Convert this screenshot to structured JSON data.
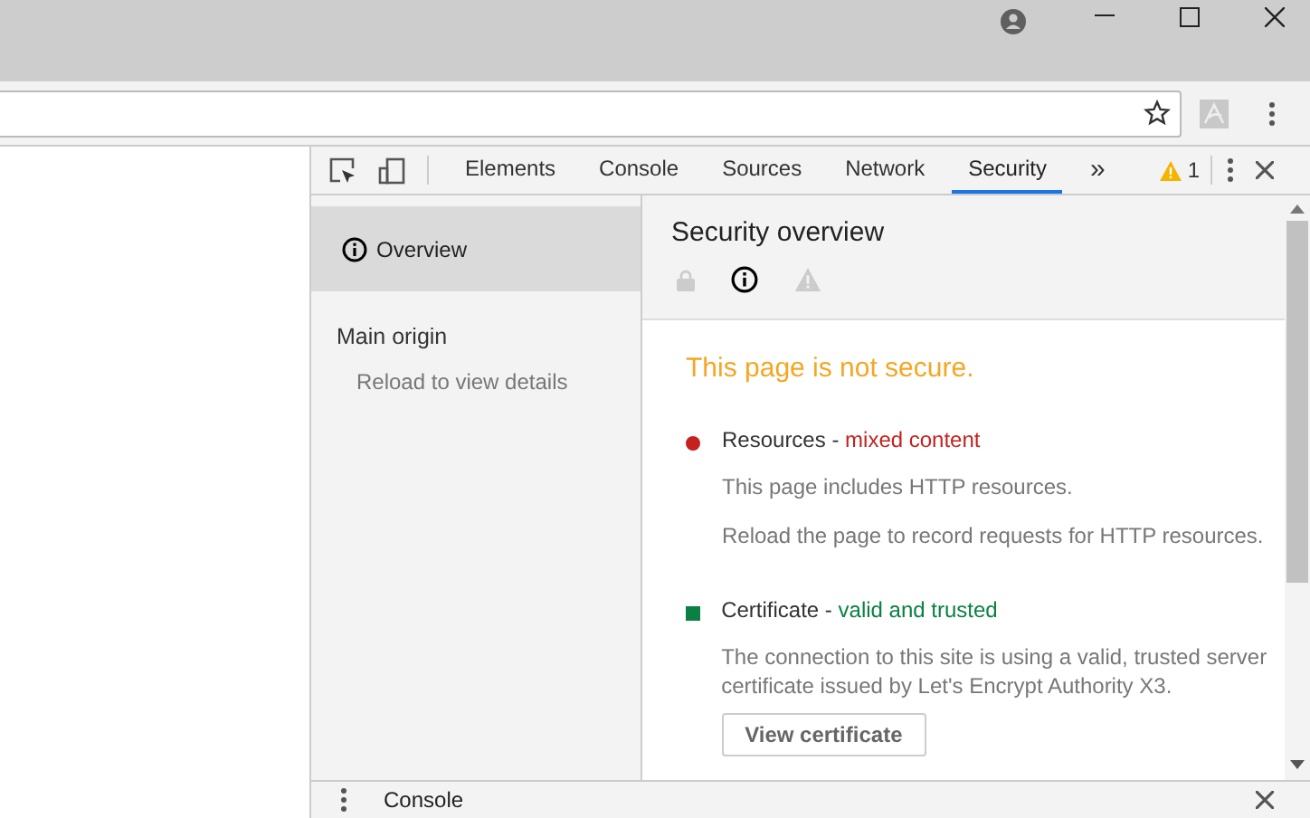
{
  "devtools": {
    "tabs": [
      {
        "label": "Elements",
        "selected": false
      },
      {
        "label": "Console",
        "selected": false
      },
      {
        "label": "Sources",
        "selected": false
      },
      {
        "label": "Network",
        "selected": false
      },
      {
        "label": "Security",
        "selected": true
      }
    ],
    "more_tabs": "»",
    "warning_count": "1"
  },
  "sidebar": {
    "items": [
      {
        "label": "Overview",
        "selected": true
      }
    ],
    "section_title": "Main origin",
    "section_note": "Reload to view details"
  },
  "overview": {
    "title": "Security overview",
    "state_icons": [
      {
        "kind": "lock",
        "selected": false
      },
      {
        "kind": "info",
        "selected": true
      },
      {
        "kind": "warning",
        "selected": false
      }
    ],
    "summary": "This page is not secure.",
    "explanations": [
      {
        "kind": "dot",
        "color": "#c5221f",
        "title": "Resources -",
        "status": "mixed content",
        "lines": [
          "This page includes HTTP resources.",
          "Reload the page to record requests for HTTP resources."
        ]
      },
      {
        "kind": "square",
        "color": "#0b8043",
        "title": "Certificate -",
        "status": "valid and trusted",
        "lines": [
          "The connection to this site is using a valid, trusted server certificate issued by Let's Encrypt Authority X3."
        ],
        "button": "View certificate"
      }
    ]
  },
  "drawer": {
    "title": "Console"
  }
}
